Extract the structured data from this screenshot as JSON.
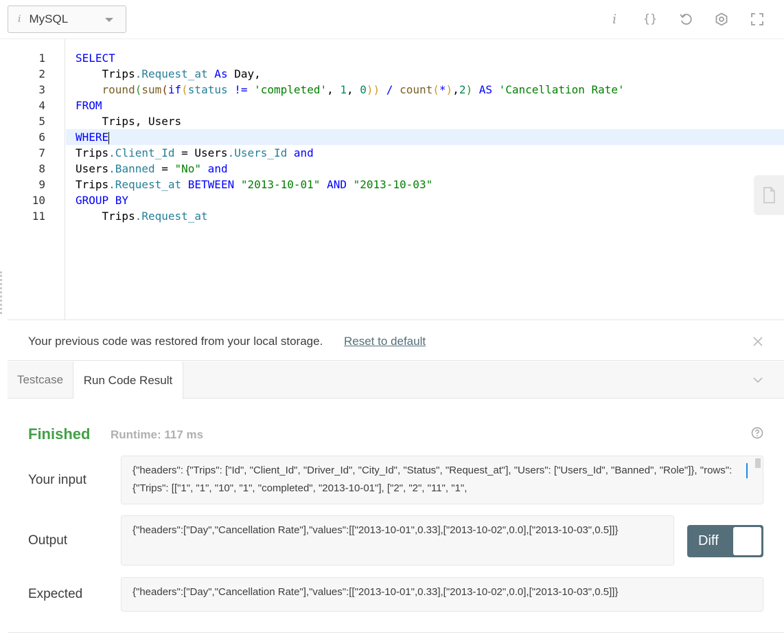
{
  "toolbar": {
    "language": "MySQL",
    "language_icon": "i",
    "icons": [
      "info-icon",
      "braces-icon",
      "reset-icon",
      "settings-icon",
      "fullscreen-icon"
    ],
    "info_glyph": "i",
    "braces_glyph": "{}"
  },
  "editor": {
    "line_numbers": [
      "1",
      "2",
      "3",
      "4",
      "5",
      "6",
      "7",
      "8",
      "9",
      "10",
      "11"
    ],
    "active_line": 6,
    "colors": {
      "keyword": "#0000ff",
      "function": "#795e26",
      "property": "#267f99",
      "string": "#a31515",
      "number": "#098658"
    },
    "tokens": {
      "l1": [
        "SELECT"
      ],
      "l2": [
        "    Trips",
        ".Request_at",
        " As",
        " Day,"
      ],
      "l3": [
        "    round",
        "(",
        "sum",
        "(",
        "if",
        "(",
        "status",
        " != ",
        "'completed'",
        ", ",
        "1",
        ", ",
        "0",
        "))",
        " / ",
        "count",
        "(",
        "*",
        ")",
        ",",
        "2",
        ")",
        " AS",
        " 'Cancellation Rate'"
      ],
      "l4": [
        "FROM"
      ],
      "l5": [
        "    Trips, Users"
      ],
      "l6": [
        "WHERE"
      ],
      "l7": [
        "Trips",
        ".Client_Id",
        " = Users",
        ".Users_Id",
        " and"
      ],
      "l8": [
        "Users",
        ".Banned",
        " = ",
        "\"No\"",
        " and"
      ],
      "l9": [
        "Trips",
        ".Request_at",
        " BETWEEN ",
        "\"2013-10-01\"",
        " AND ",
        "\"2013-10-03\""
      ],
      "l10": [
        "GROUP BY"
      ],
      "l11": [
        "    Trips",
        ".Request_at"
      ]
    }
  },
  "notice": {
    "text": "Your previous code was restored from your local storage.",
    "link": "Reset to default"
  },
  "tabs": {
    "testcase": "Testcase",
    "result": "Run Code Result"
  },
  "result": {
    "status": "Finished",
    "runtime": "Runtime: 117 ms",
    "input_label": "Your input",
    "input_value": "{\"headers\": {\"Trips\": [\"Id\", \"Client_Id\", \"Driver_Id\", \"City_Id\", \"Status\", \"Request_at\"], \"Users\": [\"Users_Id\", \"Banned\", \"Role\"]}, \"rows\": {\"Trips\": [[\"1\", \"1\", \"10\", \"1\", \"completed\", \"2013-10-01\"], [\"2\", \"2\", \"11\", \"1\",",
    "output_label": "Output",
    "output_value": "{\"headers\":[\"Day\",\"Cancellation Rate\"],\"values\":[[\"2013-10-01\",0.33],[\"2013-10-02\",0.0],[\"2013-10-03\",0.5]]}",
    "expected_label": "Expected",
    "expected_value": "{\"headers\":[\"Day\",\"Cancellation Rate\"],\"values\":[[\"2013-10-01\",0.33],[\"2013-10-02\",0.0],[\"2013-10-03\",0.5]]}",
    "diff_label": "Diff"
  }
}
